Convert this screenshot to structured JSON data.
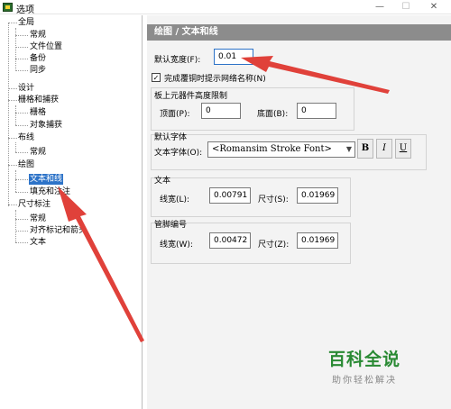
{
  "window": {
    "title": "选项",
    "min_symbol": "—",
    "max_symbol": "☐",
    "close_symbol": "✕"
  },
  "tree": {
    "items": [
      {
        "label": "全局",
        "level": 0
      },
      {
        "label": "常规",
        "level": 1
      },
      {
        "label": "文件位置",
        "level": 1
      },
      {
        "label": "备份",
        "level": 1
      },
      {
        "label": "同步",
        "level": 1
      },
      {
        "label": "设计",
        "level": 0
      },
      {
        "label": "栅格和捕获",
        "level": 0
      },
      {
        "label": "栅格",
        "level": 1
      },
      {
        "label": "对象捕获",
        "level": 1
      },
      {
        "label": "布线",
        "level": 0
      },
      {
        "label": "常规",
        "level": 1
      },
      {
        "label": "绘图",
        "level": 0
      },
      {
        "label": "文本和线",
        "level": 1,
        "selected": true
      },
      {
        "label": "填充和注注",
        "level": 1
      },
      {
        "label": "尺寸标注",
        "level": 0
      },
      {
        "label": "常规",
        "level": 1
      },
      {
        "label": "对齐标记和箭头",
        "level": 1
      },
      {
        "label": "文本",
        "level": 1
      }
    ]
  },
  "panel": {
    "header": "绘图 / 文本和线",
    "default_width": {
      "label": "默认宽度(F):",
      "value": "0.01"
    },
    "complete_checkbox": {
      "label": "完成覆铜时提示网络名称(N)",
      "checked": true
    },
    "board_group": {
      "title": "板上元器件高度限制",
      "top": {
        "label": "顶面(P):",
        "value": "0"
      },
      "bottom": {
        "label": "底面(B):",
        "value": "0"
      }
    },
    "font_group": {
      "title": "默认字体",
      "font_label": "文本字体(O):",
      "font_value": "<Romansim Stroke Font>",
      "bold": "B",
      "italic": "I",
      "underline": "U"
    },
    "text_group": {
      "title": "文本",
      "line_width": {
        "label": "线宽(L):",
        "value": "0.00791"
      },
      "size": {
        "label": "尺寸(S):",
        "value": "0.01969"
      }
    },
    "pin_group": {
      "title": "管脚编号",
      "line_width": {
        "label": "线宽(W):",
        "value": "0.00472"
      },
      "size": {
        "label": "尺寸(Z):",
        "value": "0.01969"
      }
    }
  },
  "watermark": {
    "logo": "百科全说",
    "subtitle": "助你轻松解决"
  },
  "colors": {
    "selection": "#2d73c8",
    "header_bg": "#8c8c8c",
    "arrow": "#e0413a",
    "watermark_green": "#2a8a34"
  }
}
